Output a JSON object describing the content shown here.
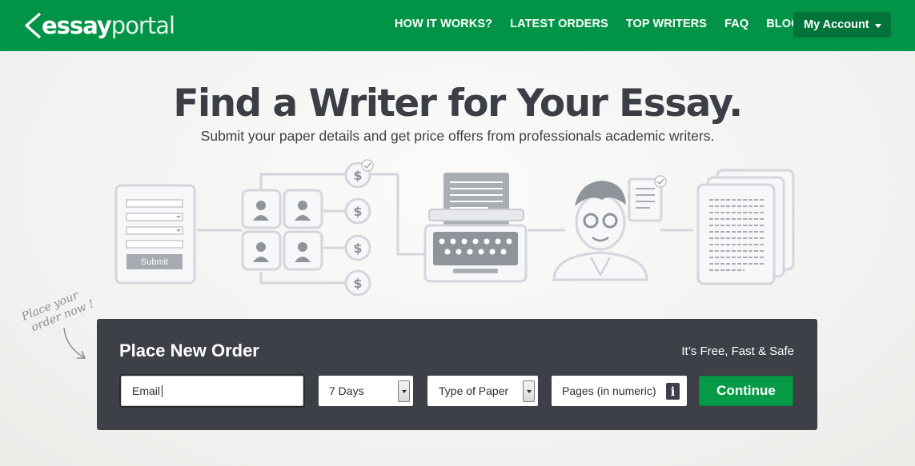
{
  "header": {
    "logo": {
      "bold": "essay",
      "light": "portal"
    },
    "nav": [
      {
        "label": "HOW IT WORKS?"
      },
      {
        "label": "LATEST ORDERS"
      },
      {
        "label": "TOP WRITERS"
      },
      {
        "label": "FAQ"
      },
      {
        "label": "BLOG"
      }
    ],
    "account_label": "My Account"
  },
  "hero": {
    "title": "Find a Writer for Your Essay.",
    "subtitle": "Submit your paper details and get price offers from professionals academic writers."
  },
  "illustration": {
    "submit_label": "Submit",
    "dollar_symbol": "$"
  },
  "handwritten": {
    "line1": "Place your",
    "line2": "order now !"
  },
  "order": {
    "title": "Place New Order",
    "tagline": "It’s Free, Fast & Safe",
    "email_value": "Email",
    "deadline_value": "7 Days",
    "paper_placeholder": "Type of Paper",
    "pages_placeholder": "Pages (in numeric)",
    "info_symbol": "i",
    "continue_label": "Continue"
  },
  "colors": {
    "brand_green": "#029446",
    "account_button": "#02743a",
    "panel": "#3d4047",
    "continue_button": "#079a46"
  },
  "icons": [
    "logo-arrow-icon",
    "chevron-down-icon",
    "info-icon",
    "user-icon",
    "dollar-icon",
    "check-icon",
    "typewriter-icon",
    "writer-avatar-icon",
    "document-icon",
    "arrow-icon"
  ]
}
